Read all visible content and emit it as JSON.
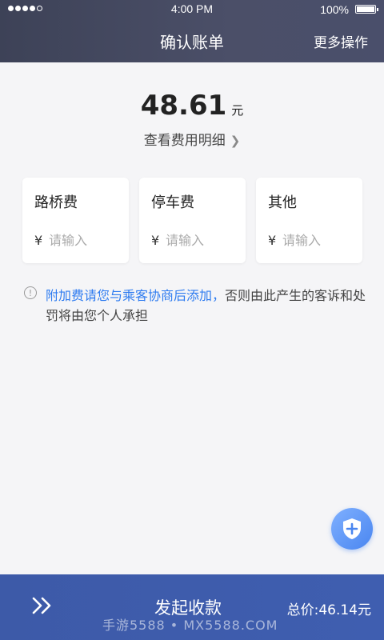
{
  "status_bar": {
    "time": "4:00 PM",
    "battery": "100%"
  },
  "nav": {
    "title": "确认账单",
    "more": "更多操作"
  },
  "summary": {
    "amount": "48.61",
    "unit": "元",
    "detail_link": "查看费用明细"
  },
  "fees": [
    {
      "label": "路桥费",
      "currency": "¥",
      "placeholder": "请输入"
    },
    {
      "label": "停车费",
      "currency": "¥",
      "placeholder": "请输入"
    },
    {
      "label": "其他",
      "currency": "¥",
      "placeholder": "请输入"
    }
  ],
  "notice": {
    "highlight": "附加费请您与乘客协商后添加，",
    "rest": "否则由此产生的客诉和处罚将由您个人承担"
  },
  "bottom_bar": {
    "collect_label": "发起收款",
    "total": "总价:46.14元"
  },
  "watermark": "手游5588 • MX5588.COM",
  "icons": {
    "float_button": "shield-plus-icon",
    "bottom_left": "double-chevron-right-icon"
  },
  "colors": {
    "header_bg": "#3d4257",
    "accent_blue": "#2f7cf0",
    "bottom_bar_bg": "#3d5aa8"
  }
}
